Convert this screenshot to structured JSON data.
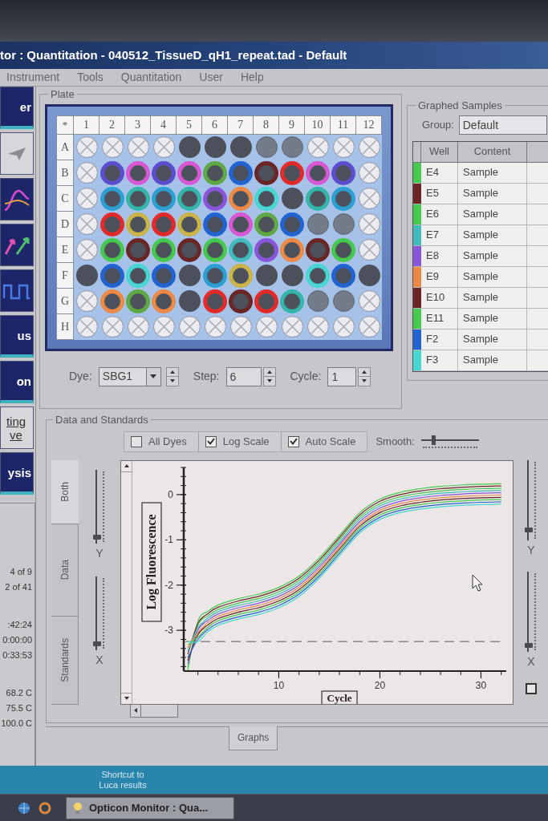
{
  "window": {
    "title": "tor : Quantitation - 040512_TissueD_qH1_repeat.tad - Default"
  },
  "menu": [
    "Instrument",
    "Tools",
    "Quantitation",
    "User",
    "Help"
  ],
  "toolbar": [
    {
      "kind": "label",
      "label": "er"
    },
    {
      "kind": "pointer"
    },
    {
      "kind": "curves"
    },
    {
      "kind": "arrows"
    },
    {
      "kind": "wave"
    },
    {
      "kind": "label",
      "label": "us"
    },
    {
      "kind": "label",
      "label": "on"
    },
    {
      "kind": "light",
      "lines": [
        "ting",
        "ve"
      ]
    },
    {
      "kind": "label",
      "label": "ysis"
    }
  ],
  "run_info": {
    "groups": [
      [
        "4 of 9",
        "2 of 41"
      ],
      [
        ":42:24",
        "0:00:00",
        "0:33:53"
      ],
      [
        "68.2 C",
        "75.5 C",
        "100.0 C"
      ]
    ]
  },
  "plate": {
    "title": "Plate",
    "corner": "*",
    "columns": [
      "1",
      "2",
      "3",
      "4",
      "5",
      "6",
      "7",
      "8",
      "9",
      "10",
      "11",
      "12"
    ],
    "rows": [
      {
        "label": "A",
        "wells": [
          {
            "kind": "empty"
          },
          {
            "kind": "empty"
          },
          {
            "kind": "empty"
          },
          {
            "kind": "empty"
          },
          {
            "kind": "sample"
          },
          {
            "kind": "sample"
          },
          {
            "kind": "sample"
          },
          {
            "kind": "dim"
          },
          {
            "kind": "dim"
          },
          {
            "kind": "empty"
          },
          {
            "kind": "empty"
          },
          {
            "kind": "empty"
          }
        ]
      },
      {
        "label": "B",
        "wells": [
          {
            "kind": "empty"
          },
          {
            "kind": "sample",
            "color": "#5b4fcf"
          },
          {
            "kind": "sample",
            "color": "#d658d2"
          },
          {
            "kind": "sample",
            "color": "#5b4fcf"
          },
          {
            "kind": "sample",
            "color": "#d658d2"
          },
          {
            "kind": "sample",
            "color": "#5ea845"
          },
          {
            "kind": "sample",
            "color": "#2263d2"
          },
          {
            "kind": "sample",
            "color": "#6a2626"
          },
          {
            "kind": "sample",
            "color": "#e22b2b"
          },
          {
            "kind": "sample",
            "color": "#d658d2"
          },
          {
            "kind": "sample",
            "color": "#5b4fcf"
          },
          {
            "kind": "empty"
          }
        ]
      },
      {
        "label": "C",
        "wells": [
          {
            "kind": "empty"
          },
          {
            "kind": "sample",
            "color": "#2b9fd2"
          },
          {
            "kind": "sample",
            "color": "#34b4aa"
          },
          {
            "kind": "sample",
            "color": "#2b9fd2"
          },
          {
            "kind": "sample",
            "color": "#34b4aa"
          },
          {
            "kind": "sample",
            "color": "#8856da"
          },
          {
            "kind": "sample",
            "color": "#ea8a46"
          },
          {
            "kind": "sample",
            "color": "#48d6d0"
          },
          {
            "kind": "sample"
          },
          {
            "kind": "sample",
            "color": "#34b4aa"
          },
          {
            "kind": "sample",
            "color": "#2b9fd2"
          },
          {
            "kind": "empty"
          }
        ]
      },
      {
        "label": "D",
        "wells": [
          {
            "kind": "empty"
          },
          {
            "kind": "sample",
            "color": "#e22b2b"
          },
          {
            "kind": "sample",
            "color": "#c9b547"
          },
          {
            "kind": "sample",
            "color": "#e22b2b"
          },
          {
            "kind": "sample",
            "color": "#c9b547"
          },
          {
            "kind": "sample",
            "color": "#2263d2"
          },
          {
            "kind": "sample",
            "color": "#d658d2"
          },
          {
            "kind": "sample",
            "color": "#5ea845"
          },
          {
            "kind": "sample",
            "color": "#2263d2"
          },
          {
            "kind": "dim"
          },
          {
            "kind": "dim"
          },
          {
            "kind": "empty"
          }
        ]
      },
      {
        "label": "E",
        "wells": [
          {
            "kind": "empty"
          },
          {
            "kind": "sample",
            "color": "#46c851"
          },
          {
            "kind": "sample",
            "color": "#6a2626"
          },
          {
            "kind": "sample",
            "color": "#46c851"
          },
          {
            "kind": "sample",
            "color": "#6a2626"
          },
          {
            "kind": "sample",
            "color": "#46c851"
          },
          {
            "kind": "sample",
            "color": "#40bcbc"
          },
          {
            "kind": "sample",
            "color": "#8856da"
          },
          {
            "kind": "sample",
            "color": "#ea8a46"
          },
          {
            "kind": "sample",
            "color": "#6a2626"
          },
          {
            "kind": "sample",
            "color": "#46c851"
          },
          {
            "kind": "empty"
          }
        ]
      },
      {
        "label": "F",
        "wells": [
          {
            "kind": "sample"
          },
          {
            "kind": "sample",
            "color": "#2263d2"
          },
          {
            "kind": "sample",
            "color": "#48d6d0"
          },
          {
            "kind": "sample",
            "color": "#2263d2"
          },
          {
            "kind": "sample"
          },
          {
            "kind": "sample",
            "color": "#2b9fd2"
          },
          {
            "kind": "sample",
            "color": "#c9b547"
          },
          {
            "kind": "sample"
          },
          {
            "kind": "sample"
          },
          {
            "kind": "sample",
            "color": "#48d6d0"
          },
          {
            "kind": "sample",
            "color": "#2263d2"
          },
          {
            "kind": "sample"
          }
        ]
      },
      {
        "label": "G",
        "wells": [
          {
            "kind": "empty"
          },
          {
            "kind": "sample",
            "color": "#ea8a46"
          },
          {
            "kind": "sample",
            "color": "#5ea845"
          },
          {
            "kind": "sample",
            "color": "#ea8a46"
          },
          {
            "kind": "sample"
          },
          {
            "kind": "sample",
            "color": "#e22b2b"
          },
          {
            "kind": "sample",
            "color": "#6a2626"
          },
          {
            "kind": "sample",
            "color": "#e22b2b"
          },
          {
            "kind": "sample",
            "color": "#34b4aa"
          },
          {
            "kind": "dim"
          },
          {
            "kind": "dim"
          },
          {
            "kind": "empty"
          }
        ]
      },
      {
        "label": "H",
        "wells": [
          {
            "kind": "empty"
          },
          {
            "kind": "empty"
          },
          {
            "kind": "empty"
          },
          {
            "kind": "empty"
          },
          {
            "kind": "empty"
          },
          {
            "kind": "empty"
          },
          {
            "kind": "empty"
          },
          {
            "kind": "empty"
          },
          {
            "kind": "empty"
          },
          {
            "kind": "empty"
          },
          {
            "kind": "empty"
          },
          {
            "kind": "empty"
          }
        ]
      }
    ],
    "dye": {
      "label": "Dye:",
      "value": "SBG1"
    },
    "step": {
      "label": "Step:",
      "value": "6"
    },
    "cycle": {
      "label": "Cycle:",
      "value": "1"
    }
  },
  "graphed_samples": {
    "title": "Graphed Samples",
    "group": {
      "label": "Group:",
      "value": "Default"
    },
    "columns": [
      "Well",
      "Content"
    ],
    "rows": [
      {
        "well": "E4",
        "content": "Sample",
        "color": "#46c851"
      },
      {
        "well": "E5",
        "content": "Sample",
        "color": "#6a2626"
      },
      {
        "well": "E6",
        "content": "Sample",
        "color": "#46c851"
      },
      {
        "well": "E7",
        "content": "Sample",
        "color": "#40bcbc"
      },
      {
        "well": "E8",
        "content": "Sample",
        "color": "#8856da"
      },
      {
        "well": "E9",
        "content": "Sample",
        "color": "#ea8a46"
      },
      {
        "well": "E10",
        "content": "Sample",
        "color": "#6a2626"
      },
      {
        "well": "E11",
        "content": "Sample",
        "color": "#46c851"
      },
      {
        "well": "F2",
        "content": "Sample",
        "color": "#2263d2"
      },
      {
        "well": "F3",
        "content": "Sample",
        "color": "#48d6d0"
      }
    ]
  },
  "data_and_standards": {
    "title": "Data and Standards",
    "options": [
      {
        "label": "All Dyes",
        "checked": false
      },
      {
        "label": "Log Scale",
        "checked": true
      },
      {
        "label": "Auto Scale",
        "checked": true
      }
    ],
    "smooth": {
      "label": "Smooth:",
      "level": 0.2
    },
    "tabs": [
      {
        "label": "Both",
        "selected": true
      },
      {
        "label": "Data",
        "selected": false
      },
      {
        "label": "Standards",
        "selected": false
      }
    ],
    "left_sliders": [
      {
        "label": "Y",
        "level": 0.05
      },
      {
        "label": "X",
        "level": 0.05
      }
    ],
    "right_sliders": [
      {
        "label": "Y",
        "level": 0.1
      },
      {
        "label": "X",
        "level": 0.05
      }
    ],
    "chart_data": {
      "type": "line",
      "xlabel": "Cycle",
      "ylabel": "Log Fluorescence",
      "x": [
        1,
        2,
        3,
        4,
        6,
        8,
        10,
        12,
        14,
        16,
        18,
        20,
        22,
        24,
        26,
        28,
        30,
        32
      ],
      "xlim": [
        0.6,
        32.5
      ],
      "ylim": [
        -3.9,
        0.6
      ],
      "xticks": [
        10,
        20,
        30
      ],
      "yticks": [
        -3,
        -2,
        -1,
        0
      ],
      "series": [
        {
          "color": "#46c851",
          "values": [
            -3.88,
            -2.8,
            -2.58,
            -2.44,
            -2.3,
            -2.2,
            -2.05,
            -1.8,
            -1.4,
            -0.9,
            -0.4,
            -0.1,
            0.05,
            0.13,
            0.18,
            0.21,
            0.23,
            0.24
          ]
        },
        {
          "color": "#6a2626",
          "values": [
            -3.53,
            -2.85,
            -2.63,
            -2.49,
            -2.35,
            -2.25,
            -2.1,
            -1.85,
            -1.45,
            -0.95,
            -0.45,
            -0.15,
            0.0,
            0.08,
            0.13,
            0.16,
            0.18,
            0.19
          ]
        },
        {
          "color": "#46c851",
          "values": [
            -3.81,
            -2.9,
            -2.68,
            -2.54,
            -2.4,
            -2.3,
            -2.15,
            -1.9,
            -1.5,
            -1.0,
            -0.5,
            -0.2,
            -0.05,
            0.03,
            0.08,
            0.11,
            0.13,
            0.14
          ]
        },
        {
          "color": "#40bcbc",
          "values": [
            -3.46,
            -2.95,
            -2.73,
            -2.59,
            -2.45,
            -2.35,
            -2.2,
            -1.95,
            -1.55,
            -1.05,
            -0.55,
            -0.25,
            -0.1,
            -0.02,
            0.03,
            0.06,
            0.08,
            0.09
          ]
        },
        {
          "color": "#8856da",
          "values": [
            -3.74,
            -3.0,
            -2.78,
            -2.64,
            -2.5,
            -2.4,
            -2.25,
            -2.0,
            -1.6,
            -1.1,
            -0.6,
            -0.3,
            -0.15,
            -0.07,
            -0.02,
            0.01,
            0.03,
            0.04
          ]
        },
        {
          "color": "#ea8a46",
          "values": [
            -3.39,
            -3.05,
            -2.83,
            -2.69,
            -2.55,
            -2.45,
            -2.3,
            -2.05,
            -1.65,
            -1.15,
            -0.65,
            -0.35,
            -0.2,
            -0.12,
            -0.07,
            -0.04,
            -0.02,
            -0.01
          ]
        },
        {
          "color": "#6a2626",
          "values": [
            -3.67,
            -3.1,
            -2.88,
            -2.74,
            -2.6,
            -2.5,
            -2.35,
            -2.1,
            -1.7,
            -1.2,
            -0.7,
            -0.4,
            -0.25,
            -0.17,
            -0.12,
            -0.09,
            -0.07,
            -0.06
          ]
        },
        {
          "color": "#46c851",
          "values": [
            -3.32,
            -3.15,
            -2.93,
            -2.79,
            -2.65,
            -2.55,
            -2.4,
            -2.15,
            -1.75,
            -1.25,
            -0.75,
            -0.45,
            -0.3,
            -0.22,
            -0.17,
            -0.14,
            -0.12,
            -0.11
          ]
        },
        {
          "color": "#2263d2",
          "values": [
            -3.6,
            -3.2,
            -2.98,
            -2.84,
            -2.7,
            -2.6,
            -2.45,
            -2.2,
            -1.8,
            -1.3,
            -0.8,
            -0.5,
            -0.35,
            -0.27,
            -0.22,
            -0.19,
            -0.17,
            -0.16
          ]
        },
        {
          "color": "#48d6d0",
          "values": [
            -3.25,
            -3.25,
            -3.03,
            -2.89,
            -2.75,
            -2.65,
            -2.5,
            -2.25,
            -1.85,
            -1.35,
            -0.85,
            -0.55,
            -0.4,
            -0.32,
            -0.27,
            -0.24,
            -0.22,
            -0.21
          ]
        }
      ],
      "ref_lines": [
        {
          "axis": "y",
          "value": -3.25
        }
      ]
    }
  },
  "bottom_tabs": [
    {
      "label": "Graphs",
      "selected": true
    }
  ],
  "desktop": {
    "shortcut": {
      "label": "Shortcut to Luca results"
    }
  },
  "taskbar": {
    "tasks": [
      {
        "label": "Opticon Monitor : Qua...",
        "selected": true
      }
    ]
  }
}
